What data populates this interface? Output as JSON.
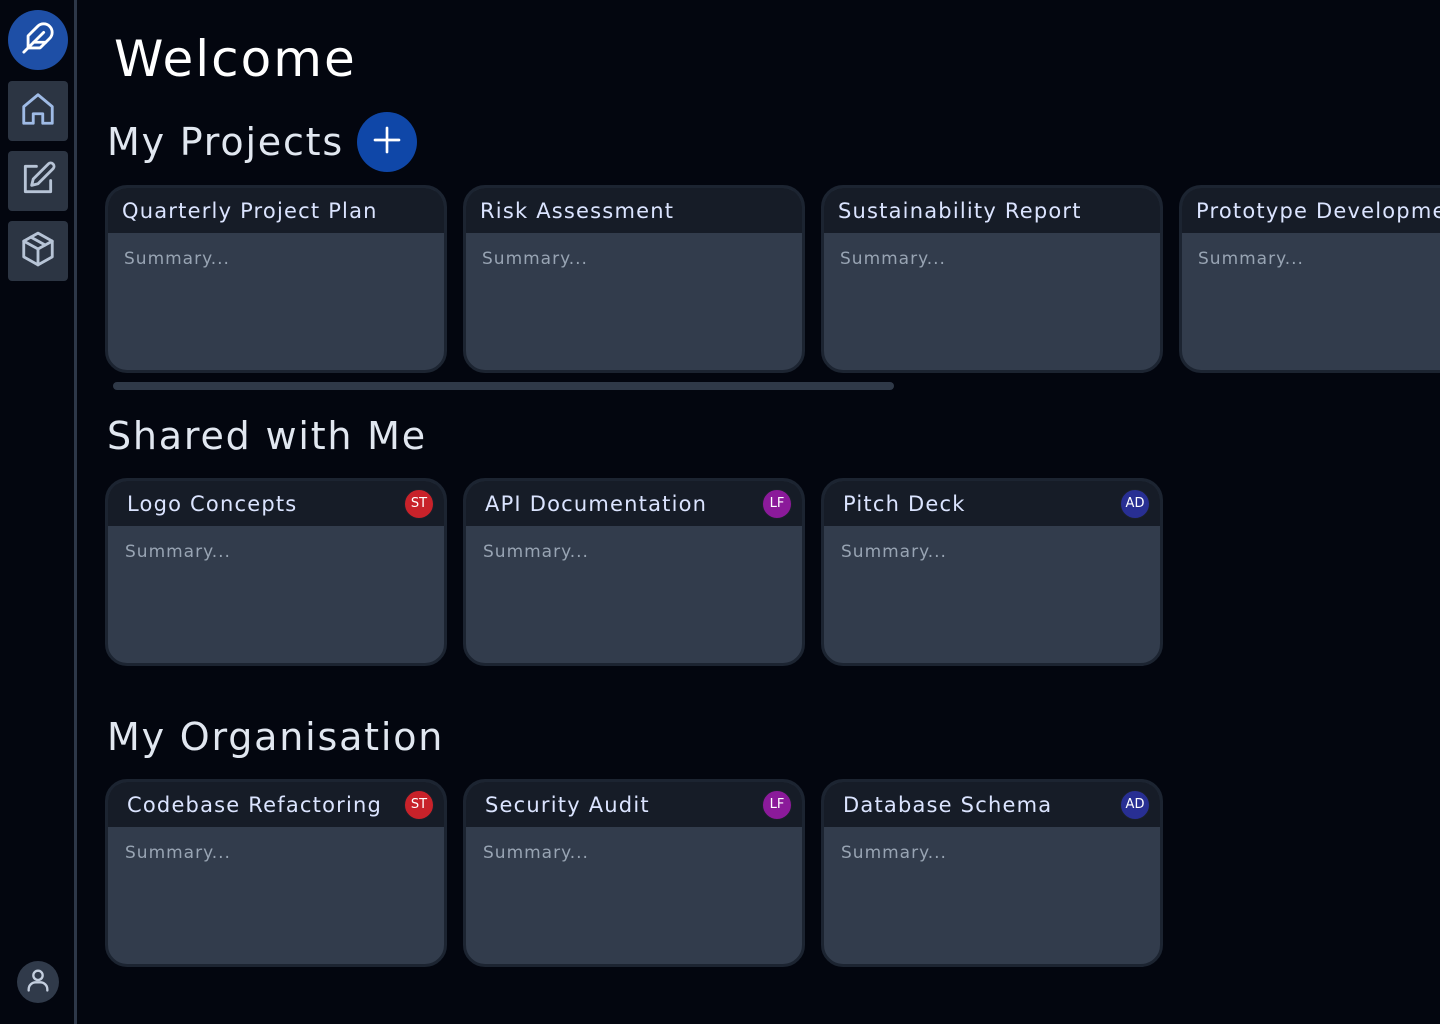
{
  "header": {
    "title": "Welcome"
  },
  "sidebar": {
    "icons": [
      "feather-icon",
      "home-icon",
      "edit-icon",
      "cube-icon",
      "user-icon"
    ]
  },
  "sections": {
    "my_projects": {
      "title": "My Projects",
      "cards": [
        {
          "title": "Quarterly Project Plan",
          "summary": "Summary..."
        },
        {
          "title": "Risk Assessment",
          "summary": "Summary..."
        },
        {
          "title": "Sustainability Report",
          "summary": "Summary..."
        },
        {
          "title": "Prototype Development",
          "summary": "Summary..."
        }
      ]
    },
    "shared": {
      "title": "Shared with Me",
      "cards": [
        {
          "title": "Logo Concepts",
          "summary": "Summary...",
          "owner": "ST",
          "owner_color": "#c8222a"
        },
        {
          "title": "API Documentation",
          "summary": "Summary...",
          "owner": "LF",
          "owner_color": "#8b1a9a"
        },
        {
          "title": "Pitch Deck",
          "summary": "Summary...",
          "owner": "AD",
          "owner_color": "#282f93"
        }
      ]
    },
    "organisation": {
      "title": "My Organisation",
      "cards": [
        {
          "title": "Codebase Refactoring",
          "summary": "Summary...",
          "owner": "ST",
          "owner_color": "#c8222a"
        },
        {
          "title": "Security Audit",
          "summary": "Summary...",
          "owner": "LF",
          "owner_color": "#8b1a9a"
        },
        {
          "title": "Database Schema",
          "summary": "Summary...",
          "owner": "AD",
          "owner_color": "#282f93"
        }
      ]
    }
  },
  "colors": {
    "background": "#03060f",
    "accent": "#0f47a8",
    "card": "#323c4c",
    "card_header": "#161c27"
  }
}
